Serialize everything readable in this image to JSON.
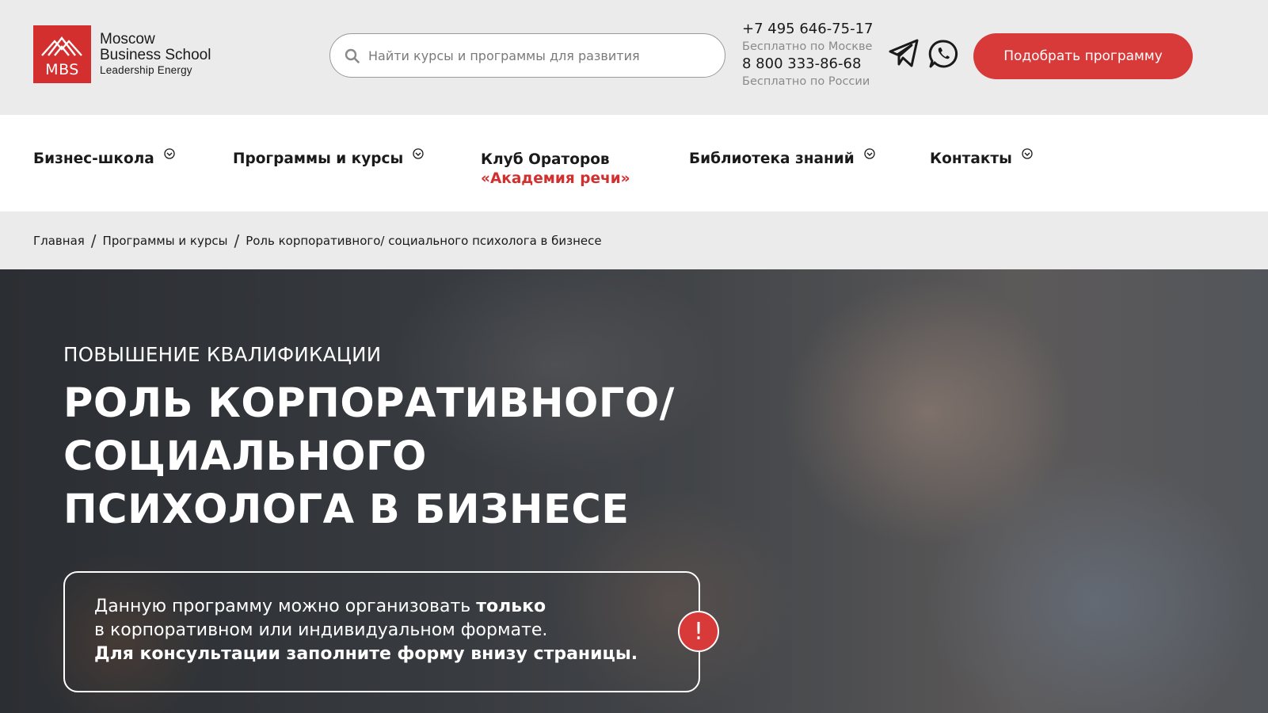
{
  "header": {
    "logo": {
      "abbr": "MBS",
      "line1": "Moscow",
      "line2": "Business School",
      "line3": "Leadership Energy"
    },
    "search": {
      "placeholder": "Найти курсы и программы для развития",
      "value": ""
    },
    "phones": [
      {
        "number": "+7 495 646-75-17",
        "note": "Бесплатно по Москве"
      },
      {
        "number": "8 800 333-86-68",
        "note": "Бесплатно по России"
      }
    ],
    "social": [
      "telegram-icon",
      "whatsapp-icon"
    ],
    "cta_label": "Подобрать программу"
  },
  "nav": {
    "business_school": "Бизнес-школа",
    "programs": "Программы и курсы",
    "orators_line1": "Клуб Ораторов",
    "orators_line2": "«Академия речи»",
    "library": "Библиотека знаний",
    "contacts": "Контакты"
  },
  "breadcrumb": {
    "home": "Главная",
    "programs": "Программы и курсы",
    "current": "Роль корпоративного/ социального психолога в бизнесе",
    "separator": "/"
  },
  "hero": {
    "kicker": "ПОВЫШЕНИЕ КВАЛИФИКАЦИИ",
    "title_lines": [
      "РОЛЬ КОРПОРАТИВНОГО/",
      "СОЦИАЛЬНОГО",
      "ПСИХОЛОГА В БИЗНЕСЕ"
    ],
    "notice": {
      "line1_normal": "Данную программу можно организовать ",
      "line1_bold": "только",
      "line2": "в корпоративном или индивидуальном формате.",
      "line3_bold": "Для консультации заполните форму внизу страницы.",
      "badge": "!"
    }
  },
  "colors": {
    "brand_red": "#d32f2f",
    "cta_red": "#d83a3a",
    "header_bg": "#ebebeb"
  }
}
